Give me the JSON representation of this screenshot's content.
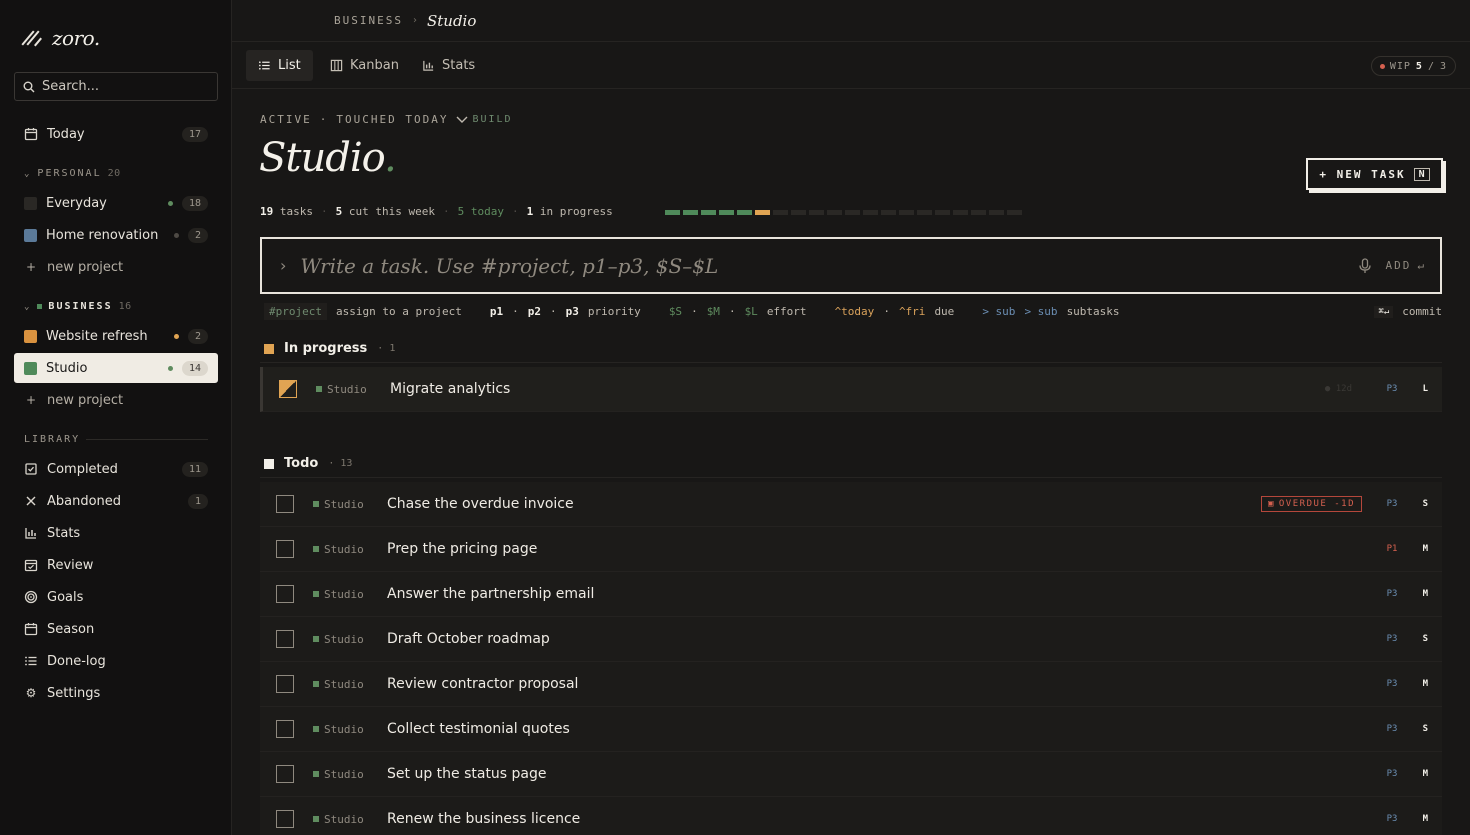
{
  "app": {
    "logo_text": "zoro."
  },
  "search": {
    "placeholder": "Search..."
  },
  "sidebar": {
    "today": {
      "label": "Today",
      "count": "17"
    },
    "personal": {
      "label": "PERSONAL",
      "count": "20",
      "projects": [
        {
          "label": "Everyday",
          "count": "18",
          "color": "#2a2825",
          "dot": "#5f8c5f"
        },
        {
          "label": "Home renovation",
          "count": "2",
          "color": "#5b7a99",
          "dot": "#4e4a45"
        }
      ],
      "new_label": "new project"
    },
    "business": {
      "label": "BUSINESS",
      "count": "16",
      "projects": [
        {
          "label": "Website refresh",
          "count": "2",
          "color": "#d9923f",
          "dot": "#e0a453"
        },
        {
          "label": "Studio",
          "count": "14",
          "color": "#4f8a5a",
          "dot": "#5f8c5f"
        }
      ],
      "new_label": "new project"
    },
    "library": {
      "label": "LIBRARY",
      "items": [
        {
          "label": "Completed",
          "count": "11",
          "icon": "check-square-icon"
        },
        {
          "label": "Abandoned",
          "count": "1",
          "icon": "x-icon"
        },
        {
          "label": "Stats",
          "icon": "bar-chart-icon"
        },
        {
          "label": "Review",
          "icon": "calendar-check-icon"
        },
        {
          "label": "Goals",
          "icon": "target-icon"
        },
        {
          "label": "Season",
          "icon": "calendar-icon"
        },
        {
          "label": "Done-log",
          "icon": "list-icon"
        },
        {
          "label": "Settings",
          "icon": "gear-icon"
        }
      ]
    }
  },
  "breadcrumb": {
    "section": "BUSINESS",
    "page": "Studio"
  },
  "views": {
    "list": "List",
    "kanban": "Kanban",
    "stats": "Stats"
  },
  "wip": {
    "label": "WIP",
    "current": "5",
    "sep": "/",
    "limit": "3"
  },
  "header": {
    "kicker_status": "ACTIVE",
    "kicker_sep": "·",
    "kicker_touched": "TOUCHED TODAY",
    "kicker_mode": "BUILD",
    "title": "Studio",
    "title_dot": ".",
    "new_task": "+ NEW TASK",
    "new_task_key": "N"
  },
  "stats": {
    "tasks_n": "19",
    "tasks_l": "tasks",
    "cut_n": "5",
    "cut_l": "cut this week",
    "today_n": "5",
    "today_l": "today",
    "prog_n": "1",
    "prog_l": "in progress",
    "bar_done": 5,
    "bar_progress": 1,
    "bar_total": 20,
    "colors": {
      "done": "#4f8a5a",
      "progress": "#e0a453",
      "empty": "#2a2825"
    }
  },
  "composer": {
    "placeholder": "Write a task. Use #project, p1–p3, $S–$L",
    "add_label": "ADD",
    "add_key": "↵"
  },
  "hints": {
    "project_chip": "#project",
    "project_text": "assign to a project",
    "p1": "p1",
    "p2": "p2",
    "p3": "p3",
    "priority_text": "priority",
    "s": "$S",
    "m": "$M",
    "l": "$L",
    "effort_text": "effort",
    "today": "^today",
    "fri": "^fri",
    "due_text": "due",
    "sub1": "> sub",
    "sub2": "> sub",
    "subtasks_text": "subtasks",
    "commit_key": "⌘↵",
    "commit_text": "commit",
    "dot": "·"
  },
  "groups": {
    "in_progress": {
      "label": "In progress",
      "count": "1",
      "color": "#e0a453"
    },
    "todo": {
      "label": "Todo",
      "count": "13",
      "color": "#f2efe8"
    }
  },
  "in_progress_tasks": [
    {
      "project": "Studio",
      "title": "Migrate analytics",
      "age": "12d",
      "priority": "P3",
      "effort": "L"
    }
  ],
  "todo_tasks": [
    {
      "project": "Studio",
      "title": "Chase the overdue invoice",
      "badge": "OVERDUE -1D",
      "priority": "P3",
      "effort": "S"
    },
    {
      "project": "Studio",
      "title": "Prep the pricing page",
      "priority": "P1",
      "effort": "M"
    },
    {
      "project": "Studio",
      "title": "Answer the partnership email",
      "priority": "P3",
      "effort": "M"
    },
    {
      "project": "Studio",
      "title": "Draft October roadmap",
      "priority": "P3",
      "effort": "S"
    },
    {
      "project": "Studio",
      "title": "Review contractor proposal",
      "priority": "P3",
      "effort": "M"
    },
    {
      "project": "Studio",
      "title": "Collect testimonial quotes",
      "priority": "P3",
      "effort": "S"
    },
    {
      "project": "Studio",
      "title": "Set up the status page",
      "priority": "P3",
      "effort": "M"
    },
    {
      "project": "Studio",
      "title": "Renew the business licence",
      "priority": "P3",
      "effort": "M"
    }
  ]
}
